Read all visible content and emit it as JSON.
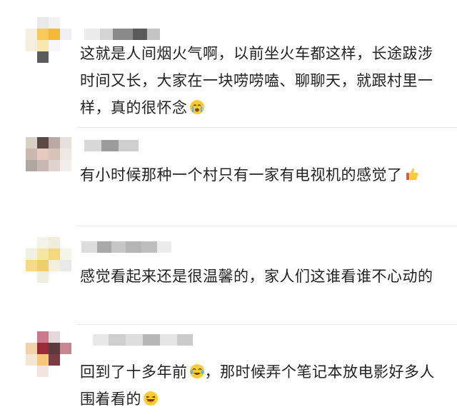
{
  "comments": [
    {
      "text": "这就是人间烟火气啊，以前坐火车都这样，长途跋涉时间又长，大家在一块唠唠嗑、聊聊天，就跟村里一样，真的很怀念",
      "trailing_emoji": "crying-face-icon"
    },
    {
      "text": "有小时候那种一个村只有一家有电视机的感觉了",
      "trailing_emoji": "thumbs-up-icon"
    },
    {
      "text": "感觉看起来还是很温馨的，家人们这谁看谁不心动的",
      "trailing_emoji": ""
    },
    {
      "text_before": "回到了十多年前",
      "inline_emoji": "tears-of-joy-icon",
      "text_after": "，那时候弄个笔记本放电影好多人围着看的",
      "trailing_emoji": "laughing-face-icon"
    }
  ]
}
